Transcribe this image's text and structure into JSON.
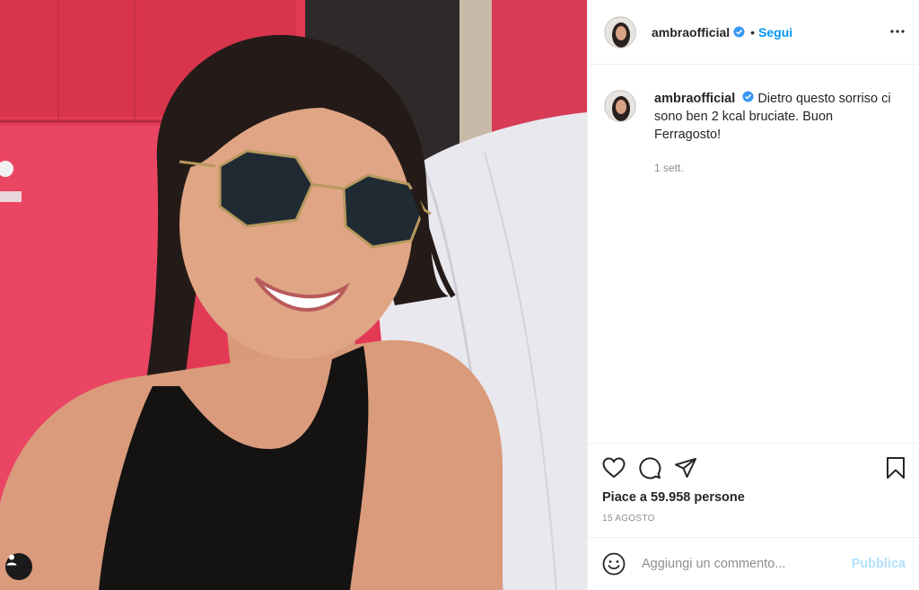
{
  "post": {
    "photo_alt": "selfie",
    "user_tag_icon": "person-icon"
  },
  "header": {
    "username": "ambraofficial",
    "verified": true,
    "dot": "•",
    "follow_label": "Segui",
    "more_icon": "more-horizontal-icon"
  },
  "caption": {
    "username": "ambraofficial",
    "text": "Dietro questo sorriso ci sono ben 2 kcal bruciate. Buon Ferragosto!",
    "time": "1 sett."
  },
  "actions": {
    "icons": [
      "heart-icon",
      "comment-icon",
      "share-icon",
      "bookmark-icon"
    ],
    "likes_label": "Piace a 59.958 persone",
    "date": "15 agosto"
  },
  "comment": {
    "placeholder": "Aggiungi un commento...",
    "publish_label": "Pubblica"
  },
  "colors": {
    "accent": "#0095f6",
    "publish_disabled": "#b2dffc",
    "muted": "#8e8e8e"
  }
}
